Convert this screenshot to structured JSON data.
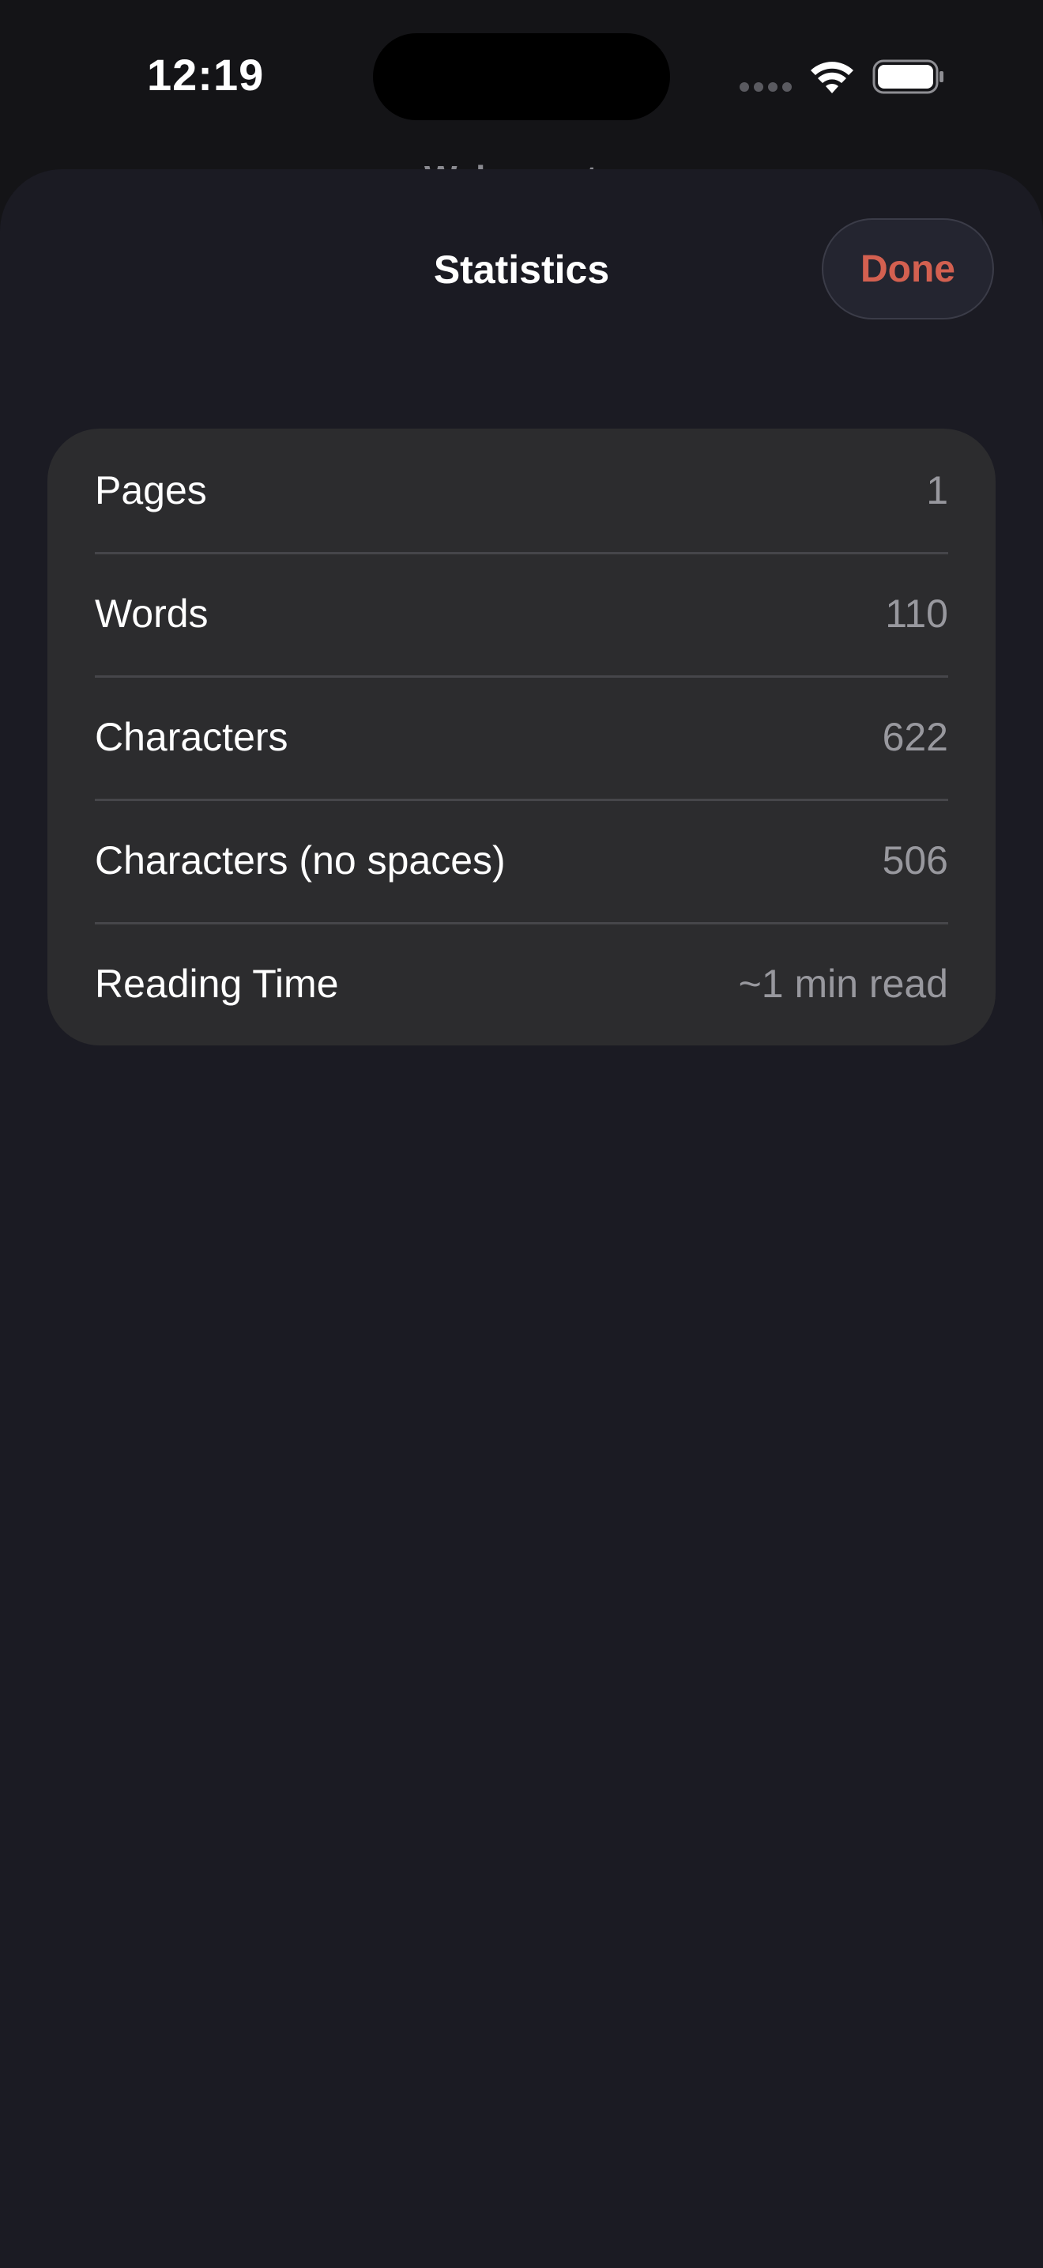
{
  "status_bar": {
    "time": "12:19",
    "icons": [
      "cellular-signal-icon",
      "wifi-icon",
      "battery-icon"
    ]
  },
  "background_title": "Welcome to",
  "sheet": {
    "title": "Statistics",
    "done_label": "Done",
    "accent_color": "#d36050"
  },
  "stats": [
    {
      "label": "Pages",
      "value": "1"
    },
    {
      "label": "Words",
      "value": "110"
    },
    {
      "label": "Characters",
      "value": "622"
    },
    {
      "label": "Characters (no spaces)",
      "value": "506"
    },
    {
      "label": "Reading Time",
      "value": "~1 min read"
    }
  ]
}
